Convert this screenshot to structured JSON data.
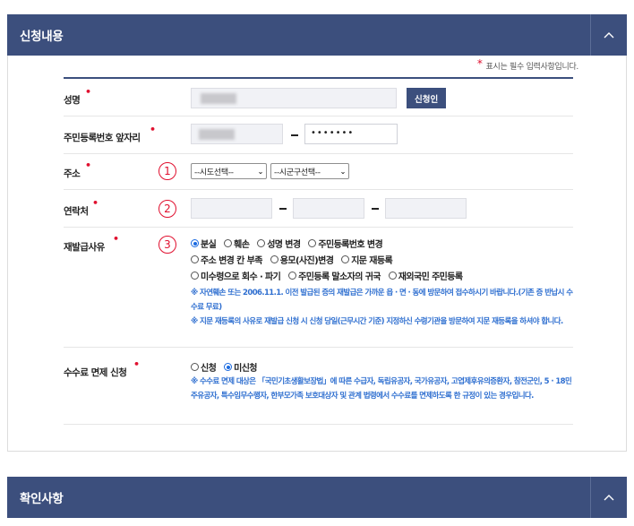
{
  "section1": {
    "title": "신청내용",
    "required_note": "표시는 필수 입력사항입니다.",
    "name": {
      "label": "성명",
      "button": "신청인"
    },
    "rrn": {
      "label": "주민등록번호 앞자리",
      "masked": "•••••••"
    },
    "address": {
      "label": "주소",
      "number": "①",
      "sido": "--시도선택--",
      "sigungu": "--시군구선택--"
    },
    "contact": {
      "label": "연락처",
      "number": "②"
    },
    "reason": {
      "label": "재발급사유",
      "number": "③",
      "options_row1": [
        "분실",
        "훼손",
        "성명 변경",
        "주민등록번호 변경"
      ],
      "options_row2": [
        "주소 변경 칸 부족",
        "용모(사진)변경",
        "지문 재등록"
      ],
      "options_row3": [
        "미수령으로 회수 · 파기",
        "주민등록 말소자의 귀국",
        "재외국민 주민등록"
      ],
      "note1": "※ 자연훼손 또는 2006.11.1. 이전 발급된 증의 재발급은 가까운 읍 · 면 · 동에 방문하여 접수하시기 바랍니다.(기존 증 반납시 수수료 무료)",
      "note2": "※ 지문 재등록의 사유로 재발급 신청 시 신청 당일(근무시간 기준) 지정하신 수령기관을 방문하여 지문 재등록을 하셔야 합니다."
    },
    "fee": {
      "label": "수수료 면제 신청",
      "options": [
        "신청",
        "미신청"
      ],
      "note": "※ 수수료 면제 대상은 「국민기초생활보장법」에 따른 수급자, 독립유공자, 국가유공자, 고엽제후유의증환자, 참전군인, 5 · 18민주유공자, 특수임무수행자, 한부모가족 보호대상자 및 관계 법령에서 수수료를 면제하도록 한 규정이 있는 경우입니다."
    }
  },
  "section2": {
    "title": "확인사항"
  },
  "colors": {
    "header": "#3c4f7d",
    "required": "#e0102f",
    "note": "#2f6fd0"
  }
}
